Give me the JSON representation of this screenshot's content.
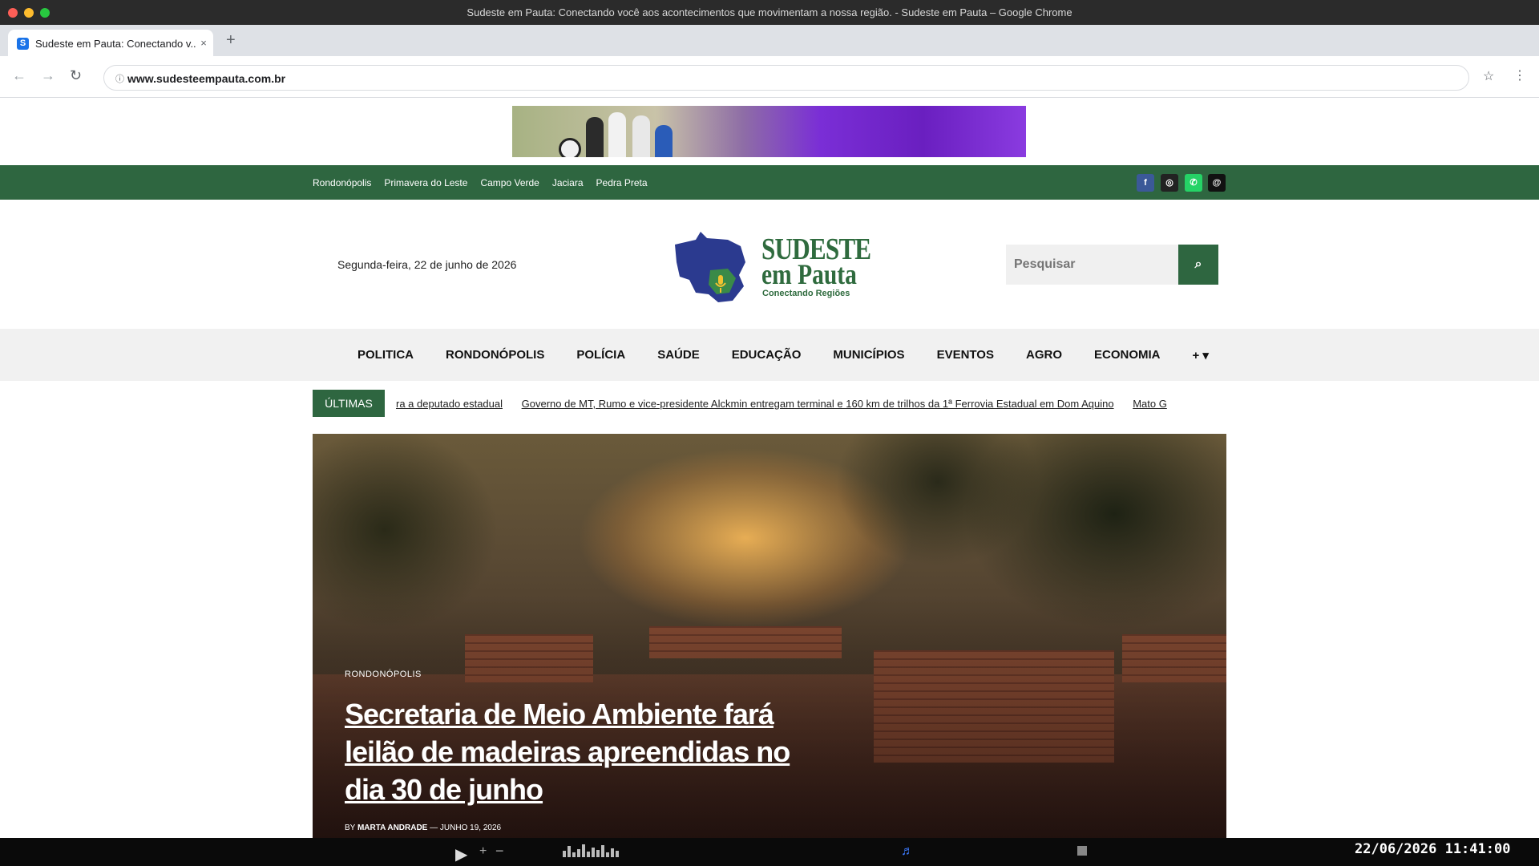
{
  "browser": {
    "window_title": "Sudeste em Pauta: Conectando você aos acontecimentos que movimentam a nossa região. - Sudeste em Pauta – Google Chrome",
    "tab_title": "Sudeste em Pauta: Conectando v...",
    "tab_favicon_letter": "S",
    "tab_close": "×",
    "new_tab": "+",
    "url": "www.sudesteempauta.com.br",
    "back": "←",
    "forward": "→",
    "reload": "↻",
    "star": "☆",
    "menu": "⋮"
  },
  "topbar": {
    "links": [
      "Rondonópolis",
      "Primavera do Leste",
      "Campo Verde",
      "Jaciara",
      "Pedra Preta"
    ],
    "social_icons": [
      "facebook-icon",
      "instagram-icon",
      "whatsapp-icon",
      "threads-icon"
    ],
    "social_glyphs": [
      "f",
      "◎",
      "✆",
      "@"
    ]
  },
  "header": {
    "date": "Segunda-feira, 22 de junho de 2026",
    "logo_line1": "SUDESTE",
    "logo_line2": "em Pauta",
    "logo_tagline": "Conectando Regiões",
    "search_placeholder": "Pesquisar",
    "search_button": "⌕"
  },
  "nav": {
    "items": [
      "POLITICA",
      "RONDONÓPOLIS",
      "POLÍCIA",
      "SAÚDE",
      "EDUCAÇÃO",
      "MUNICÍPIOS",
      "EVENTOS",
      "AGRO",
      "ECONOMIA",
      "+ ▾"
    ]
  },
  "ticker": {
    "label": "ÚLTIMAS",
    "items": [
      "ra a deputado estadual",
      "Governo de MT, Rumo e vice-presidente Alckmin entregam terminal e 160 km de trilhos da 1ª Ferrovia Estadual em Dom Aquino",
      "Mato G"
    ]
  },
  "hero": {
    "category": "RONDONÓPOLIS",
    "title": "Secretaria de Meio Ambiente fará leilão de madeiras apreendidas no dia 30 de junho",
    "by": "BY",
    "author": "MARTA ANDRADE",
    "separator": "—",
    "date": "JUNHO 19, 2026"
  },
  "taskbar": {
    "play": "▶",
    "plus": "+",
    "minus": "−",
    "note": "♬",
    "clock": "22/06/2026 11:41:00"
  },
  "colors": {
    "brand_green": "#2e6640",
    "logo_blue": "#2b3a8f"
  }
}
